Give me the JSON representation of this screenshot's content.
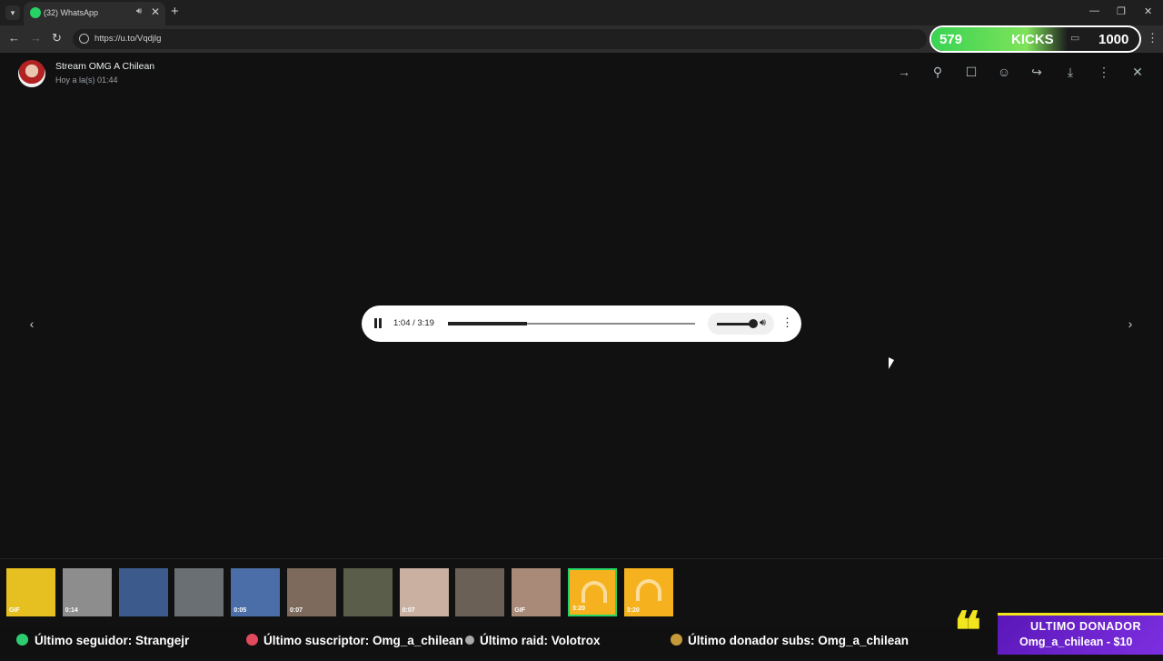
{
  "browser": {
    "tab_title": "(32) WhatsApp",
    "url": "https://u.to/Vqdjlg"
  },
  "kicks_widget": {
    "count": "579",
    "label": "KICKS",
    "goal": "1000"
  },
  "viewer": {
    "sender": "Stream OMG A Chilean",
    "timestamp": "Hoy a la(s) 01:44",
    "header_icons": [
      "reply-arrow-icon",
      "pin-icon",
      "bookmark-icon",
      "emoji-icon",
      "forward-icon",
      "download-icon",
      "more-vert-icon",
      "close-icon"
    ]
  },
  "audio_player": {
    "time": "1:04 / 3:19",
    "progress": 0.321,
    "volume": 1.0
  },
  "thumbnails": [
    {
      "badge": "GIF",
      "color": "#e6c020"
    },
    {
      "badge": "0:14",
      "color": "#8d8d8d"
    },
    {
      "badge": "",
      "color": "#3c5b8c"
    },
    {
      "badge": "",
      "color": "#6a6f74"
    },
    {
      "badge": "0:05",
      "color": "#4c6ea8"
    },
    {
      "badge": "0:07",
      "color": "#7d6a5c"
    },
    {
      "badge": "",
      "color": "#5a5d4a"
    },
    {
      "badge": "0:07",
      "color": "#c9b0a0"
    },
    {
      "badge": "",
      "color": "#6b6055"
    },
    {
      "badge": "GIF",
      "color": "#a98a78"
    },
    {
      "badge": "3:20",
      "color": "#f5b21e",
      "selected": true
    },
    {
      "badge": "3:20",
      "color": "#f5b21e"
    }
  ],
  "ticker": {
    "follower": "Último seguidor: Strangejr",
    "subscriber": "Último suscriptor: Omg_a_chilean",
    "raid": "Último raid: Volotrox",
    "donor_subs": "Último donador subs: Omg_a_chilean"
  },
  "donor_box": {
    "title": "ULTIMO DONADOR",
    "value": "Omg_a_chilean - $10"
  }
}
